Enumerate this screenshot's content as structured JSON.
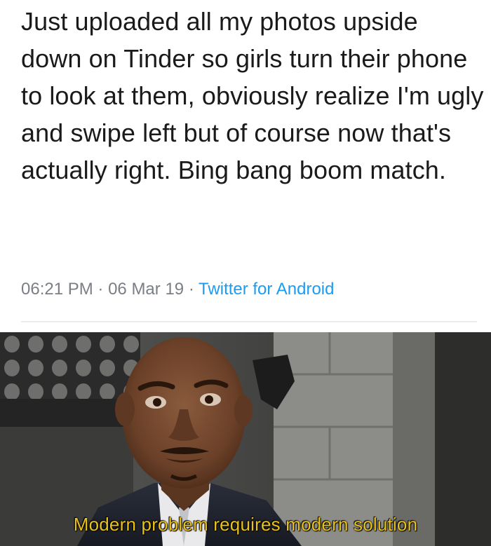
{
  "tweet": {
    "text": "Just uploaded all my photos upside down on Tinder so girls turn their phone to look at them, obviously realize I'm ugly and swipe left but of course now that's actually right. Bing bang boom match.",
    "time": "06:21 PM",
    "separator": "·",
    "date": "06 Mar 19",
    "source": "Twitter for Android",
    "source_color": "#1d9bf0"
  },
  "meme": {
    "caption": "Modern problem requires modern solution",
    "caption_color": "#e8c21a"
  }
}
